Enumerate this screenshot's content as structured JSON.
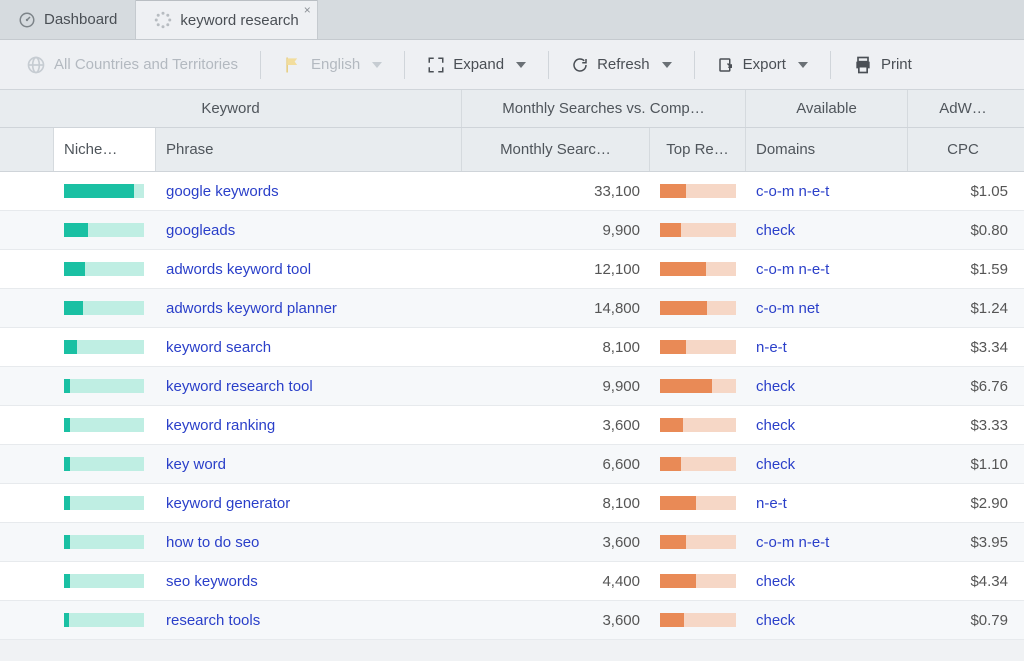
{
  "tabs": [
    {
      "label": "Dashboard",
      "icon": "dashboard"
    },
    {
      "label": "keyword research",
      "icon": "spinner",
      "active": true,
      "closable": true
    }
  ],
  "toolbar": {
    "countries_label": "All Countries and Territories",
    "language_label": "English",
    "expand_label": "Expand",
    "refresh_label": "Refresh",
    "export_label": "Export",
    "print_label": "Print"
  },
  "columns": {
    "group_keyword": "Keyword",
    "group_searches": "Monthly Searches vs. Comp…",
    "group_available": "Available",
    "group_adwords": "AdW…",
    "niche": "Niche…",
    "phrase": "Phrase",
    "monthly": "Monthly Searc…",
    "top": "Top Re…",
    "domains": "Domains",
    "cpc": "CPC"
  },
  "rows": [
    {
      "niche_pct": 88,
      "phrase": "google keywords",
      "monthly": "33,100",
      "top_pct": 34,
      "domains": "c-o-m n-e-t",
      "cpc": "$1.05"
    },
    {
      "niche_pct": 30,
      "phrase": "googleads",
      "monthly": "9,900",
      "top_pct": 28,
      "domains": "check",
      "cpc": "$0.80"
    },
    {
      "niche_pct": 26,
      "phrase": "adwords keyword tool",
      "monthly": "12,100",
      "top_pct": 60,
      "domains": "c-o-m n-e-t",
      "cpc": "$1.59"
    },
    {
      "niche_pct": 24,
      "phrase": "adwords keyword planner",
      "monthly": "14,800",
      "top_pct": 62,
      "domains": "c-o-m net",
      "cpc": "$1.24"
    },
    {
      "niche_pct": 16,
      "phrase": "keyword search",
      "monthly": "8,100",
      "top_pct": 34,
      "domains": "n-e-t",
      "cpc": "$3.34"
    },
    {
      "niche_pct": 8,
      "phrase": "keyword research tool",
      "monthly": "9,900",
      "top_pct": 68,
      "domains": "check",
      "cpc": "$6.76"
    },
    {
      "niche_pct": 8,
      "phrase": "keyword ranking",
      "monthly": "3,600",
      "top_pct": 30,
      "domains": "check",
      "cpc": "$3.33"
    },
    {
      "niche_pct": 7,
      "phrase": "key word",
      "monthly": "6,600",
      "top_pct": 28,
      "domains": "check",
      "cpc": "$1.10"
    },
    {
      "niche_pct": 7,
      "phrase": "keyword generator",
      "monthly": "8,100",
      "top_pct": 48,
      "domains": "n-e-t",
      "cpc": "$2.90"
    },
    {
      "niche_pct": 7,
      "phrase": "how to do seo",
      "monthly": "3,600",
      "top_pct": 34,
      "domains": "c-o-m n-e-t",
      "cpc": "$3.95"
    },
    {
      "niche_pct": 7,
      "phrase": "seo keywords",
      "monthly": "4,400",
      "top_pct": 48,
      "domains": "check",
      "cpc": "$4.34"
    },
    {
      "niche_pct": 6,
      "phrase": "research tools",
      "monthly": "3,600",
      "top_pct": 32,
      "domains": "check",
      "cpc": "$0.79"
    }
  ]
}
